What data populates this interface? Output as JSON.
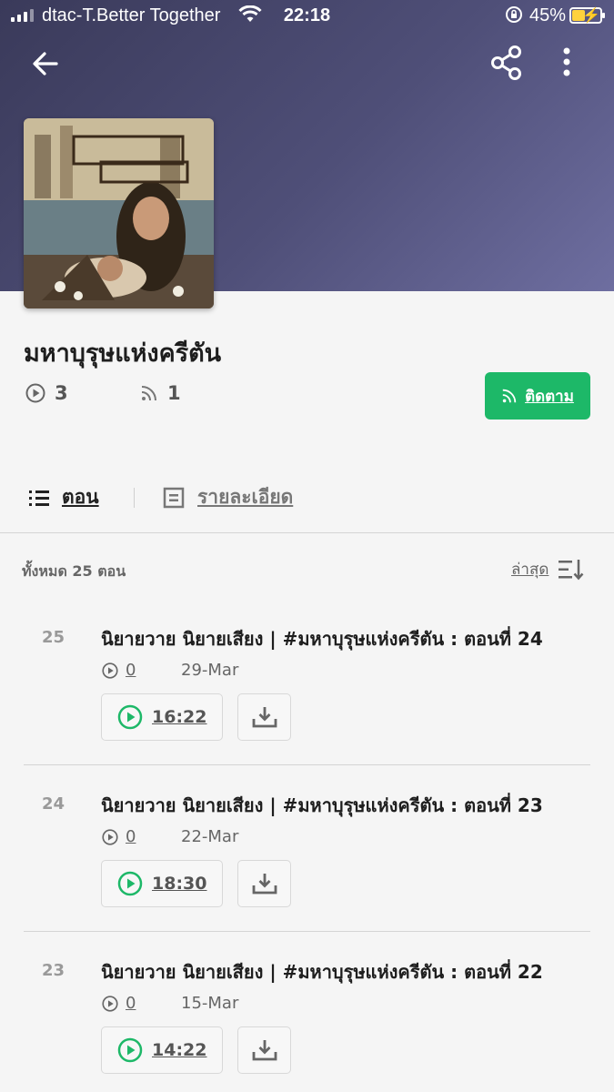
{
  "status_bar": {
    "carrier": "dtac-T.Better Together",
    "time": "22:18",
    "battery": "45%",
    "battery_level": 0.45
  },
  "book": {
    "title": "มหาบุรุษแห่งครีตัน",
    "plays": "3",
    "subscribers": "1",
    "follow_label": "ติดตาม"
  },
  "tabs": {
    "episodes": "ตอน",
    "details": "รายละเอียด"
  },
  "list": {
    "total": "ทั้งหมด 25 ตอน",
    "sort_label": "ล่าสุด"
  },
  "episodes": [
    {
      "number": "25",
      "title": "นิยายวาย นิยายเสียง | #มหาบุรุษแห่งครีตัน : ตอนที่ 24",
      "plays": "0",
      "date": "29-Mar",
      "duration": "16:22"
    },
    {
      "number": "24",
      "title": "นิยายวาย นิยายเสียง | #มหาบุรุษแห่งครีตัน : ตอนที่ 23",
      "plays": "0",
      "date": "22-Mar",
      "duration": "18:30"
    },
    {
      "number": "23",
      "title": "นิยายวาย นิยายเสียง | #มหาบุรุษแห่งครีตัน : ตอนที่ 22",
      "plays": "0",
      "date": "15-Mar",
      "duration": "14:22"
    }
  ],
  "colors": {
    "accent_green": "#1db868",
    "header_purple": "#4f4f78"
  }
}
